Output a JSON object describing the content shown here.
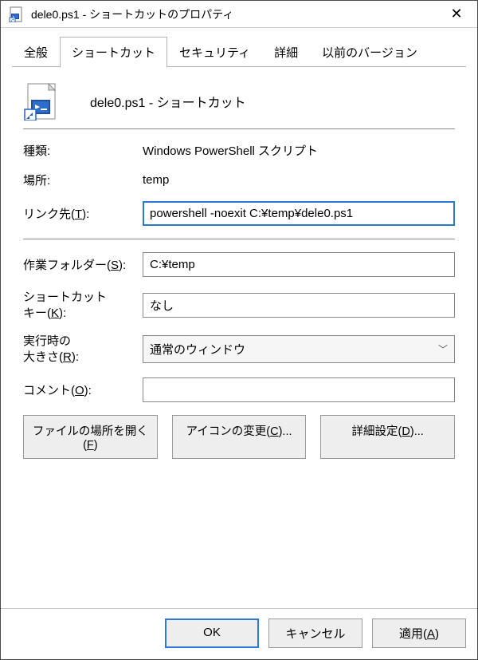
{
  "window": {
    "title": "dele0.ps1 - ショートカットのプロパティ"
  },
  "tabs": {
    "general": "全般",
    "shortcut": "ショートカット",
    "security": "セキュリティ",
    "details": "詳細",
    "previous": "以前のバージョン"
  },
  "header": {
    "name": "dele0.ps1 - ショートカット"
  },
  "fields": {
    "type_label": "種類:",
    "type_value": "Windows PowerShell スクリプト",
    "location_label": "場所:",
    "location_value": "temp",
    "target_label_pre": "リンク先(",
    "target_label_key": "T",
    "target_label_post": "):",
    "target_value": "powershell -noexit C:¥temp¥dele0.ps1",
    "startin_label_pre": "作業フォルダー(",
    "startin_label_key": "S",
    "startin_label_post": "):",
    "startin_value": "C:¥temp",
    "hotkey_label_line1": "ショートカット",
    "hotkey_label_line2_pre": "キー(",
    "hotkey_label_line2_key": "K",
    "hotkey_label_line2_post": "):",
    "hotkey_value": "なし",
    "run_label_line1": "実行時の",
    "run_label_line2_pre": "大きさ(",
    "run_label_line2_key": "R",
    "run_label_line2_post": "):",
    "run_value": "通常のウィンドウ",
    "comment_label_pre": "コメント(",
    "comment_label_key": "O",
    "comment_label_post": "):",
    "comment_value": ""
  },
  "buttons": {
    "open_location_pre": "ファイルの場所を開く(",
    "open_location_key": "F",
    "open_location_post": ")",
    "change_icon_pre": "アイコンの変更(",
    "change_icon_key": "C",
    "change_icon_post": ")...",
    "advanced_pre": "詳細設定(",
    "advanced_key": "D",
    "advanced_post": ")..."
  },
  "footer": {
    "ok": "OK",
    "cancel": "キャンセル",
    "apply_pre": "適用(",
    "apply_key": "A",
    "apply_post": ")"
  }
}
